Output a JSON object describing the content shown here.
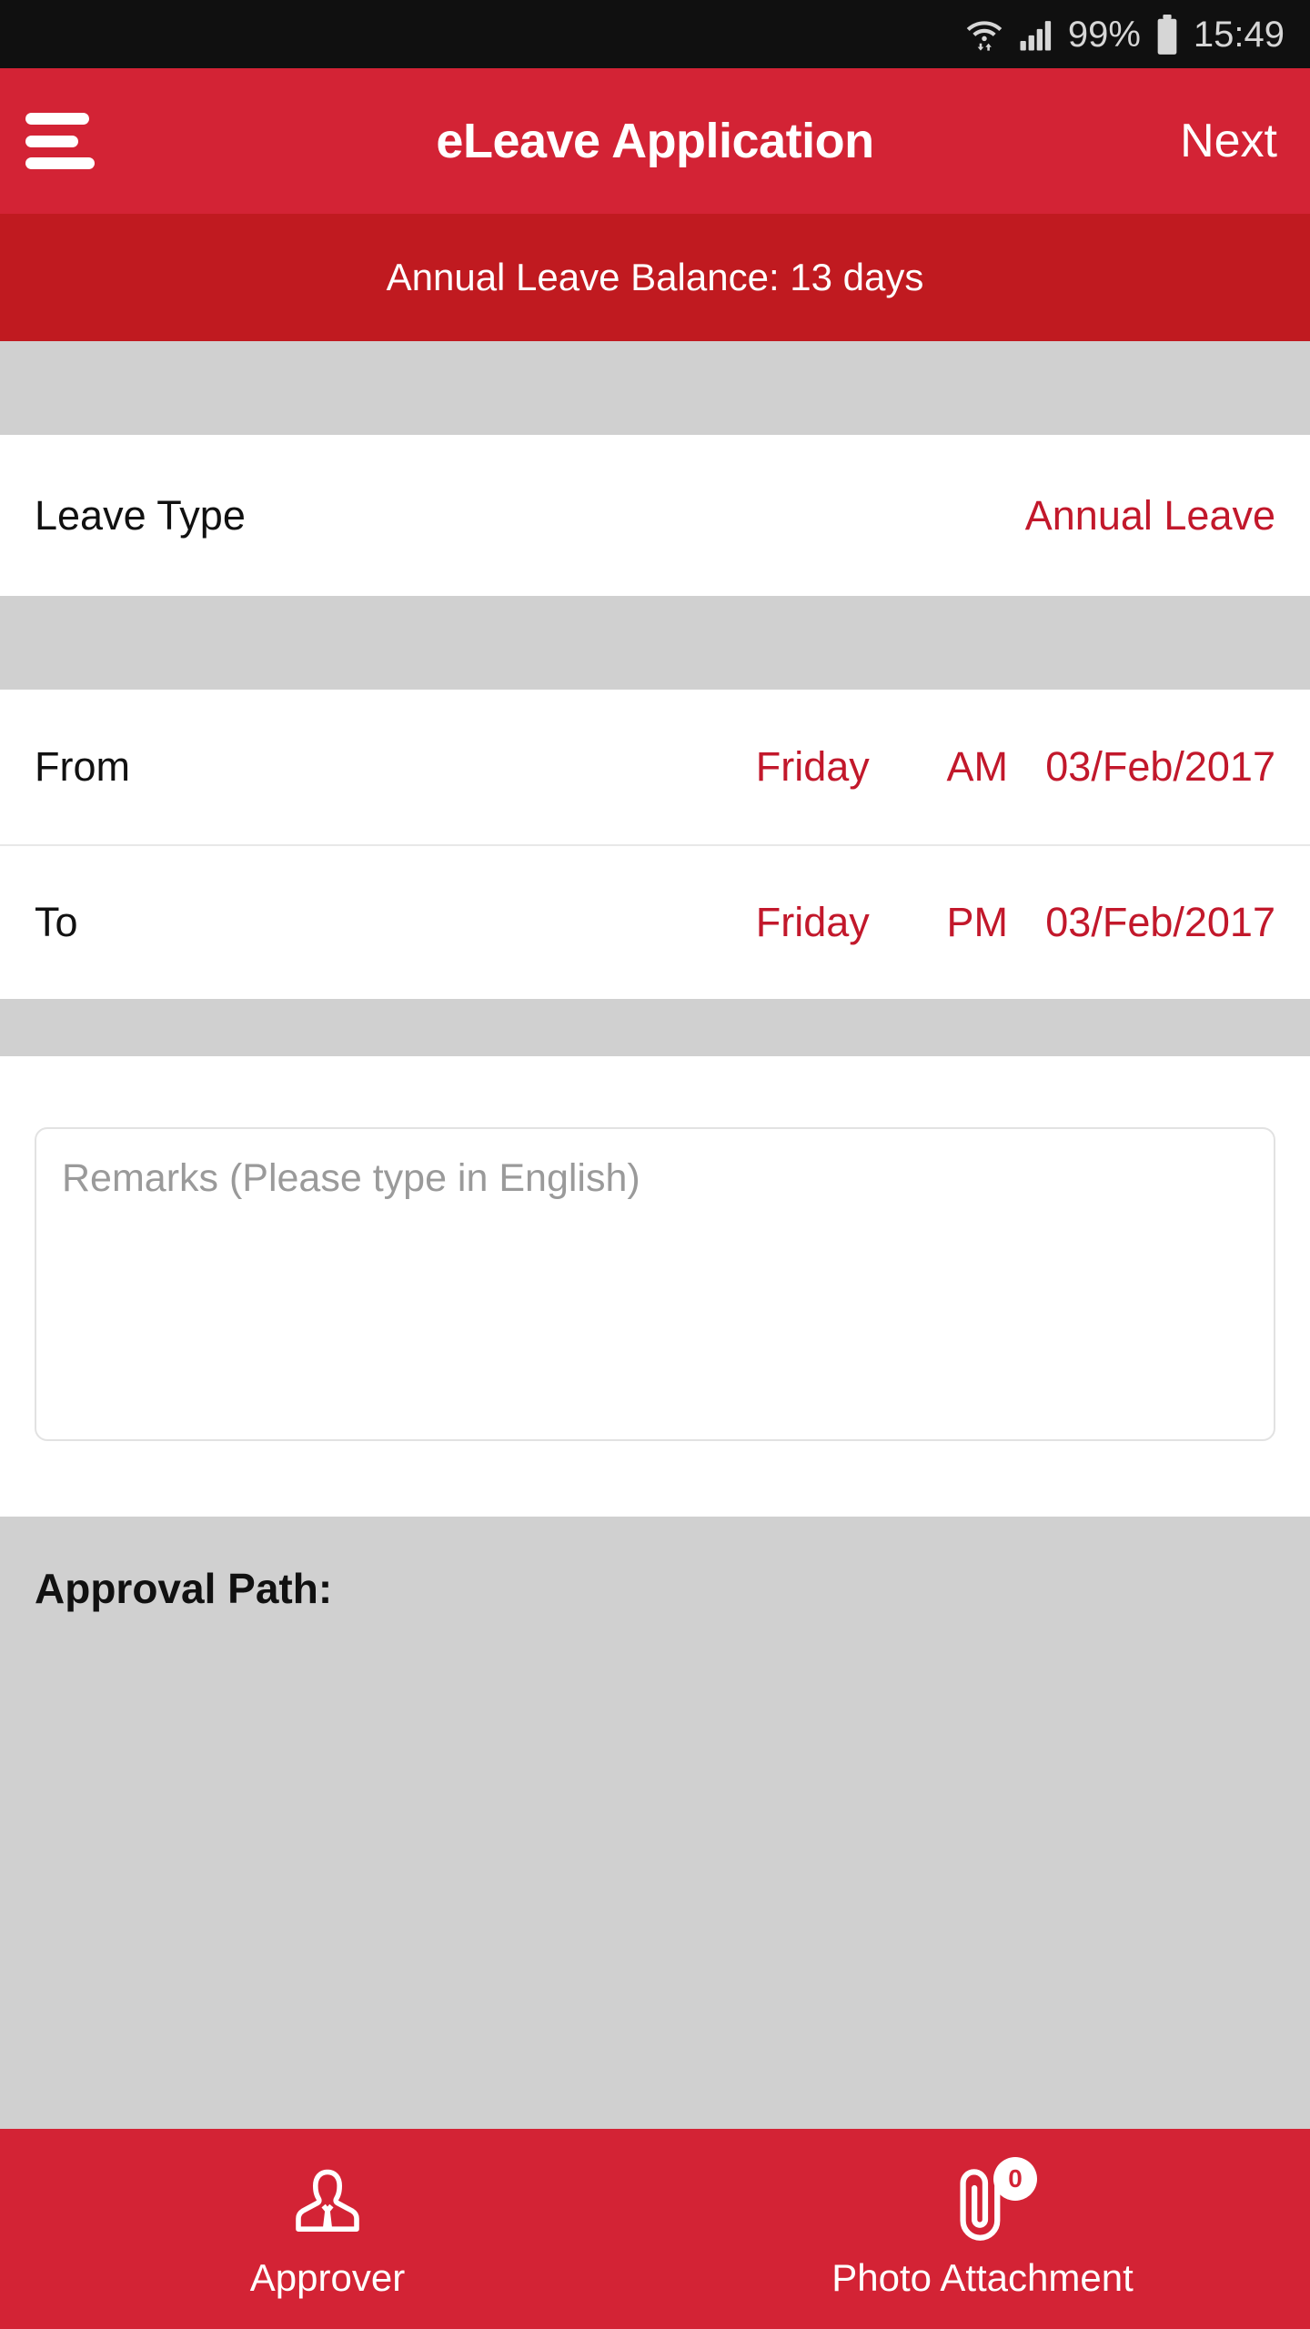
{
  "status_bar": {
    "wifi_icon": "wifi-icon",
    "signal_icon": "cellular-signal-icon",
    "battery_percent": "99%",
    "battery_icon": "battery-icon",
    "time": "15:49"
  },
  "header": {
    "menu_icon": "hamburger-menu-icon",
    "title": "eLeave Application",
    "action_label": "Next"
  },
  "balance": {
    "text": "Annual Leave Balance: 13 days"
  },
  "form": {
    "leave_type": {
      "label": "Leave Type",
      "value": "Annual Leave"
    },
    "from": {
      "label": "From",
      "day": "Friday",
      "period": "AM",
      "date": "03/Feb/2017"
    },
    "to": {
      "label": "To",
      "day": "Friday",
      "period": "PM",
      "date": "03/Feb/2017"
    },
    "remarks": {
      "value": "",
      "placeholder": "Remarks (Please type in English)"
    }
  },
  "approval": {
    "title": "Approval Path:"
  },
  "bottom_bar": {
    "approver": {
      "icon": "person-icon",
      "label": "Approver"
    },
    "attachment": {
      "icon": "paperclip-icon",
      "label": "Photo Attachment",
      "badge_count": "0"
    }
  },
  "colors": {
    "header_red": "#d32335",
    "balance_red": "#c01a20",
    "value_red": "#c2182b",
    "spacer_gray": "#d0d0d0",
    "status_black": "#101010"
  }
}
